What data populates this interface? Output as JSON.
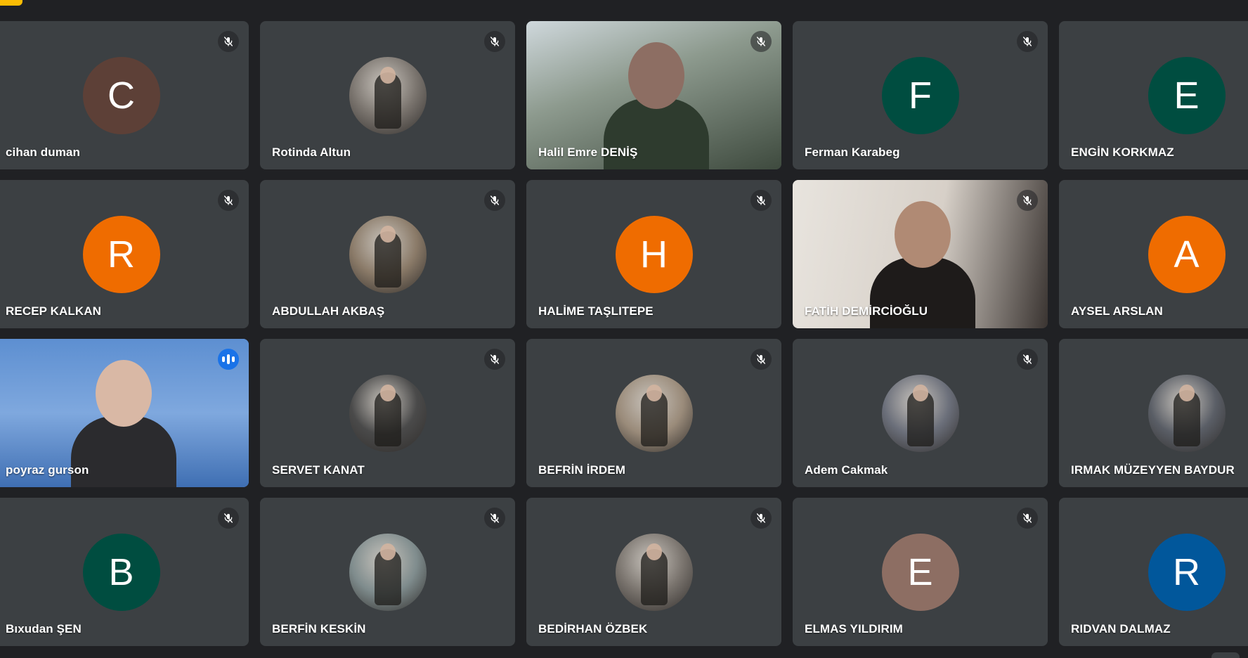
{
  "colors": {
    "background": "#202124",
    "tile": "#3c4043",
    "accent_speaking": "#1a73e8",
    "tile_active_border": "#4a86e8"
  },
  "participants": [
    {
      "name": "cihan duman",
      "kind": "initial",
      "initial": "C",
      "color": "#5d4037",
      "mic": "muted"
    },
    {
      "name": "Rotinda Altun",
      "kind": "photo",
      "mic": "muted"
    },
    {
      "name": "Halil Emre DENİŞ",
      "kind": "video",
      "mic": "muted"
    },
    {
      "name": "Ferman Karabeg",
      "kind": "initial",
      "initial": "F",
      "color": "#004d40",
      "mic": "muted"
    },
    {
      "name": "ENGİN KORKMAZ",
      "kind": "initial",
      "initial": "E",
      "color": "#004d40",
      "mic": "none"
    },
    {
      "name": "RECEP KALKAN",
      "kind": "initial",
      "initial": "R",
      "color": "#ef6c00",
      "mic": "muted"
    },
    {
      "name": "ABDULLAH AKBAŞ",
      "kind": "photo",
      "mic": "muted"
    },
    {
      "name": "HALİME TAŞLITEPE",
      "kind": "initial",
      "initial": "H",
      "color": "#ef6c00",
      "mic": "muted"
    },
    {
      "name": "FATİH DEMİRCİOĞLU",
      "kind": "video",
      "mic": "muted"
    },
    {
      "name": "AYSEL ARSLAN",
      "kind": "initial",
      "initial": "A",
      "color": "#ef6c00",
      "mic": "none"
    },
    {
      "name": "poyraz gurson",
      "kind": "video",
      "mic": "speaking",
      "active": true
    },
    {
      "name": "SERVET KANAT",
      "kind": "photo",
      "mic": "muted"
    },
    {
      "name": "BEFRİN İRDEM",
      "kind": "photo",
      "mic": "muted"
    },
    {
      "name": "Adem Cakmak",
      "kind": "photo",
      "mic": "muted"
    },
    {
      "name": "IRMAK MÜZEYYEN BAYDUR",
      "kind": "photo",
      "mic": "none"
    },
    {
      "name": "Bıxudan ŞEN",
      "kind": "initial",
      "initial": "B",
      "color": "#004d40",
      "mic": "muted"
    },
    {
      "name": "BERFİN KESKİN",
      "kind": "photo",
      "mic": "muted"
    },
    {
      "name": "BEDİRHAN ÖZBEK",
      "kind": "photo",
      "mic": "muted"
    },
    {
      "name": "ELMAS YILDIRIM",
      "kind": "initial",
      "initial": "E",
      "color": "#8d6e63",
      "mic": "muted"
    },
    {
      "name": "RIDVAN DALMAZ",
      "kind": "initial",
      "initial": "R",
      "color": "#01579b",
      "mic": "none"
    }
  ]
}
